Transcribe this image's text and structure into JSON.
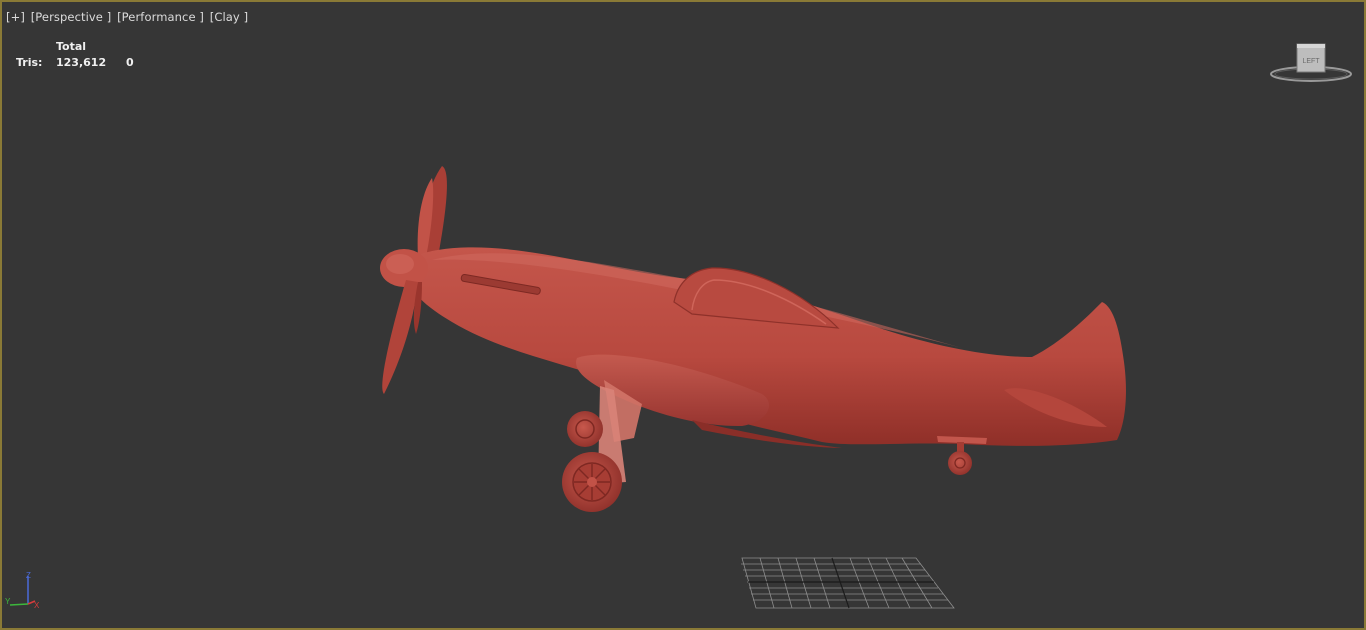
{
  "viewport": {
    "menu": {
      "plus": "[+]",
      "view": "[Perspective ]",
      "mode": "[Performance ]",
      "shading": "[Clay ]"
    },
    "stats": {
      "header": "Total",
      "tris_label": "Tris:",
      "tris_total": "123,612",
      "tris_selected": "0"
    },
    "viewcube": {
      "face_label": "LEFT"
    },
    "axis": {
      "z": "Z",
      "x": "X",
      "y": "Y"
    }
  },
  "colors": {
    "viewport_bg": "#363636",
    "active_border": "#8a7a36",
    "clay_model": "#b8493f"
  }
}
